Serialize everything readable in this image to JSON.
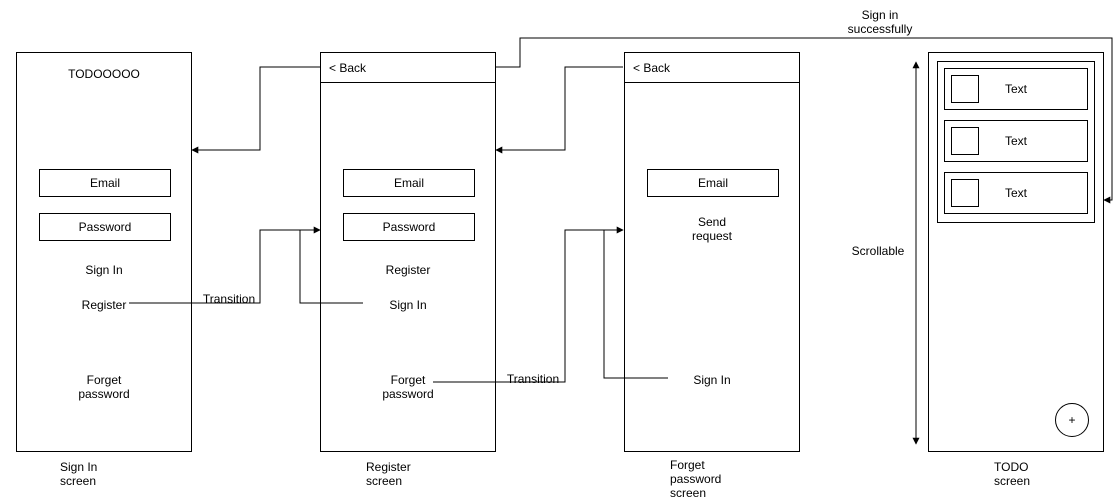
{
  "diagram": {
    "sign_in_success_label": "Sign in\nsuccessfully",
    "scrollable_label": "Scrollable",
    "transition1_label": "Transition",
    "transition2_label": "Transition"
  },
  "screen1": {
    "title": "TODOOOOO",
    "email": "Email",
    "password": "Password",
    "sign_in": "Sign In",
    "register": "Register",
    "forget_password": "Forget\npassword",
    "caption": "Sign In\nscreen"
  },
  "screen2": {
    "back": "< Back",
    "email": "Email",
    "password": "Password",
    "register": "Register",
    "sign_in": "Sign In",
    "forget_password": "Forget\npassword",
    "caption": "Register\nscreen"
  },
  "screen3": {
    "back": "< Back",
    "email": "Email",
    "send_request": "Send\nrequest",
    "sign_in": "Sign In",
    "caption": "Forget\npassword\nscreen"
  },
  "screen4": {
    "item1": "Text",
    "item2": "Text",
    "item3": "Text",
    "fab": "+",
    "caption": "TODO\nscreen"
  }
}
